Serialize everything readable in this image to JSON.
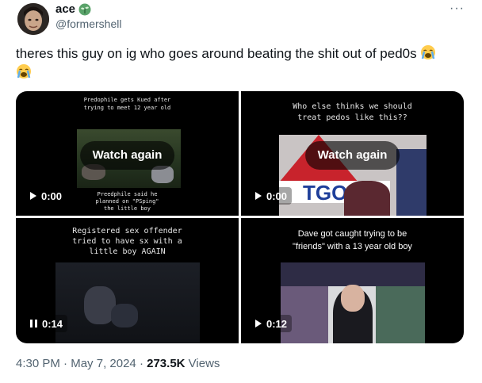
{
  "author": {
    "display_name": "ace",
    "handle": "@formershell",
    "badge_icon": "plant-emoji-icon"
  },
  "more_label": "···",
  "tweet": {
    "text": "theres this guy on ig who goes around beating the shit out of ped0s",
    "emojis": [
      "loudly-crying-face-emoji",
      "loudly-crying-face-emoji"
    ]
  },
  "media": [
    {
      "caption_top": "Predophile gets Kued after trying to meet 12 year old",
      "caption_bottom": "Preedphile said he planned on \"PSping\" the little boy",
      "overlay": "Watch again",
      "time": "0:00",
      "state_icon": "play-icon"
    },
    {
      "caption_top": "Who else thinks we should treat pedos like this??",
      "overlay": "Watch again",
      "time": "0:00",
      "state_icon": "play-icon"
    },
    {
      "caption_top": "Registered sex offender tried to have sx with a little boy AGAIN",
      "time": "0:14",
      "state_icon": "pause-icon"
    },
    {
      "caption_top": "Dave got caught trying to be \"friends\" with a 13 year old boy",
      "time": "0:12",
      "state_icon": "play-icon"
    }
  ],
  "footer": {
    "time": "4:30 PM",
    "dot1": "·",
    "date": "May 7, 2024",
    "dot2": "·",
    "views_count": "273.5K",
    "views_label": "Views"
  },
  "colors": {
    "text": "#0f1419",
    "secondary": "#536471",
    "media_bg": "#000000"
  }
}
